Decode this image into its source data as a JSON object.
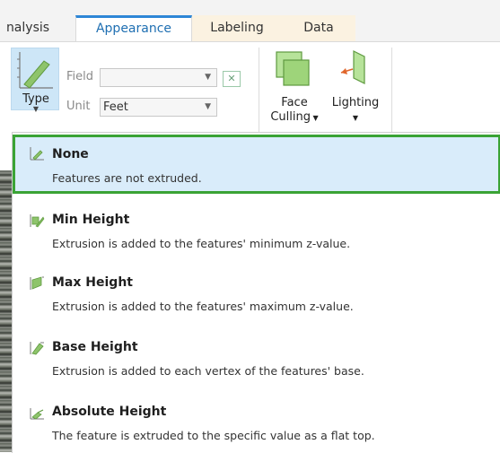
{
  "tabs": [
    {
      "label": "nalysis",
      "active": false
    },
    {
      "label": "Appearance",
      "active": true
    },
    {
      "label": "Labeling",
      "active": false
    },
    {
      "label": "Data",
      "active": false
    }
  ],
  "ribbon": {
    "type_label": "Type",
    "field_label": "Field",
    "field_value": "",
    "unit_label": "Unit",
    "unit_value": "Feet",
    "face_culling_label_line1": "Face",
    "face_culling_label_line2": "Culling",
    "lighting_label": "Lighting"
  },
  "options": [
    {
      "title": "None",
      "description": "Features are not extruded.",
      "icon": "none-extrusion-icon",
      "selected": true
    },
    {
      "title": "Min Height",
      "description": "Extrusion is added to the features' minimum z-value.",
      "icon": "min-height-icon",
      "selected": false
    },
    {
      "title": "Max Height",
      "description": "Extrusion is added to the features' maximum z-value.",
      "icon": "max-height-icon",
      "selected": false
    },
    {
      "title": "Base Height",
      "description": "Extrusion is added to each vertex of the features' base.",
      "icon": "base-height-icon",
      "selected": false
    },
    {
      "title": "Absolute Height",
      "description": "The feature is extruded to the specific value as a flat top.",
      "icon": "absolute-height-icon",
      "selected": false
    }
  ],
  "colors": {
    "accent": "#2e86d6",
    "selected_bg": "#d9ecfa",
    "selected_border": "#3aa335",
    "context_tab_bg": "#fbf2e1"
  }
}
